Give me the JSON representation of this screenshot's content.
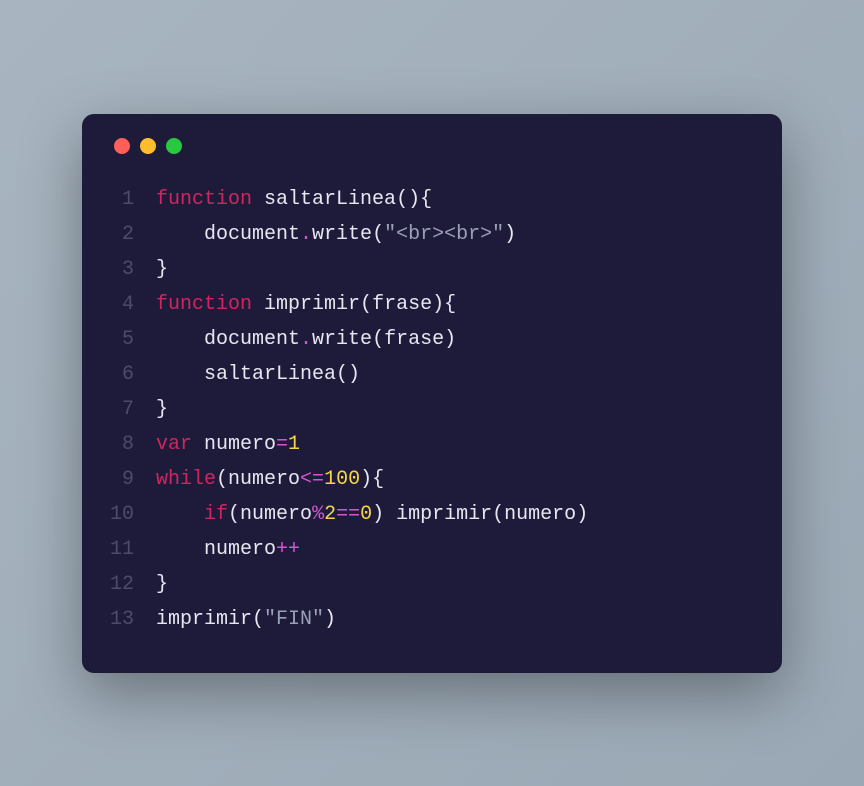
{
  "window": {
    "dots": [
      "red",
      "yellow",
      "green"
    ]
  },
  "code": {
    "lines": [
      {
        "num": "1",
        "tokens": [
          {
            "t": "function ",
            "c": "tk-kw"
          },
          {
            "t": "saltarLinea",
            "c": "tk-fn"
          },
          {
            "t": "(){",
            "c": "tk-punc"
          }
        ]
      },
      {
        "num": "2",
        "indent": "    ",
        "tokens": [
          {
            "t": "document",
            "c": "tk-id"
          },
          {
            "t": ".",
            "c": "tk-op"
          },
          {
            "t": "write",
            "c": "tk-fn"
          },
          {
            "t": "(",
            "c": "tk-punc"
          },
          {
            "t": "\"<br><br>\"",
            "c": "tk-str"
          },
          {
            "t": ")",
            "c": "tk-punc"
          }
        ]
      },
      {
        "num": "3",
        "tokens": [
          {
            "t": "}",
            "c": "tk-punc"
          }
        ]
      },
      {
        "num": "4",
        "tokens": [
          {
            "t": "function ",
            "c": "tk-kw"
          },
          {
            "t": "imprimir",
            "c": "tk-fn"
          },
          {
            "t": "(",
            "c": "tk-punc"
          },
          {
            "t": "frase",
            "c": "tk-id"
          },
          {
            "t": "){",
            "c": "tk-punc"
          }
        ]
      },
      {
        "num": "5",
        "indent": "    ",
        "tokens": [
          {
            "t": "document",
            "c": "tk-id"
          },
          {
            "t": ".",
            "c": "tk-op"
          },
          {
            "t": "write",
            "c": "tk-fn"
          },
          {
            "t": "(",
            "c": "tk-punc"
          },
          {
            "t": "frase",
            "c": "tk-id"
          },
          {
            "t": ")",
            "c": "tk-punc"
          }
        ]
      },
      {
        "num": "6",
        "indent": "    ",
        "tokens": [
          {
            "t": "saltarLinea",
            "c": "tk-fn"
          },
          {
            "t": "()",
            "c": "tk-punc"
          }
        ]
      },
      {
        "num": "7",
        "tokens": [
          {
            "t": "}",
            "c": "tk-punc"
          }
        ]
      },
      {
        "num": "8",
        "tokens": [
          {
            "t": "var ",
            "c": "tk-kw"
          },
          {
            "t": "numero",
            "c": "tk-id"
          },
          {
            "t": "=",
            "c": "tk-op"
          },
          {
            "t": "1",
            "c": "tk-num"
          }
        ]
      },
      {
        "num": "9",
        "tokens": [
          {
            "t": "while",
            "c": "tk-kw"
          },
          {
            "t": "(",
            "c": "tk-punc"
          },
          {
            "t": "numero",
            "c": "tk-id"
          },
          {
            "t": "<=",
            "c": "tk-op"
          },
          {
            "t": "100",
            "c": "tk-num"
          },
          {
            "t": "){",
            "c": "tk-punc"
          }
        ]
      },
      {
        "num": "10",
        "indent": "    ",
        "tokens": [
          {
            "t": "if",
            "c": "tk-kw"
          },
          {
            "t": "(",
            "c": "tk-punc"
          },
          {
            "t": "numero",
            "c": "tk-id"
          },
          {
            "t": "%",
            "c": "tk-op"
          },
          {
            "t": "2",
            "c": "tk-num"
          },
          {
            "t": "==",
            "c": "tk-op"
          },
          {
            "t": "0",
            "c": "tk-num"
          },
          {
            "t": ") ",
            "c": "tk-punc"
          },
          {
            "t": "imprimir",
            "c": "tk-fn"
          },
          {
            "t": "(",
            "c": "tk-punc"
          },
          {
            "t": "numero",
            "c": "tk-id"
          },
          {
            "t": ")",
            "c": "tk-punc"
          }
        ]
      },
      {
        "num": "11",
        "indent": "    ",
        "tokens": [
          {
            "t": "numero",
            "c": "tk-id"
          },
          {
            "t": "++",
            "c": "tk-op"
          }
        ]
      },
      {
        "num": "12",
        "tokens": [
          {
            "t": "}",
            "c": "tk-punc"
          }
        ]
      },
      {
        "num": "13",
        "tokens": [
          {
            "t": "imprimir",
            "c": "tk-fn"
          },
          {
            "t": "(",
            "c": "tk-punc"
          },
          {
            "t": "\"FIN\"",
            "c": "tk-str"
          },
          {
            "t": ")",
            "c": "tk-punc"
          }
        ]
      }
    ]
  }
}
